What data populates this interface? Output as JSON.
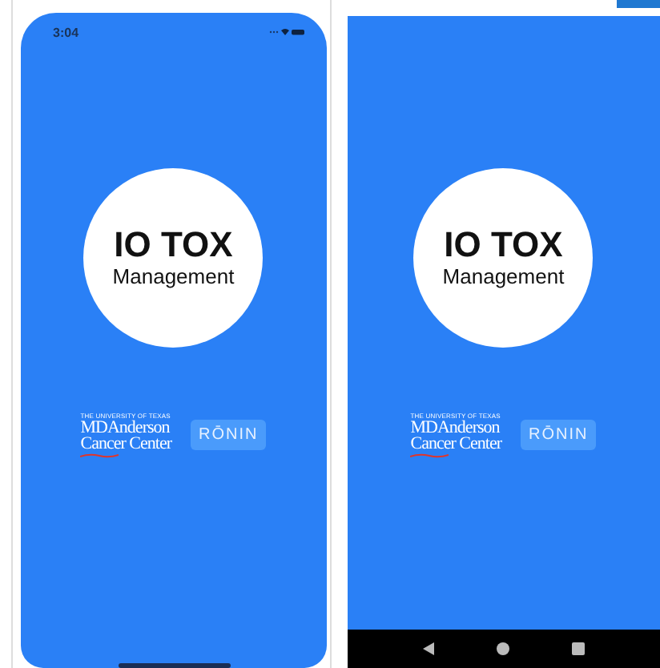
{
  "screens": [
    {
      "kind": "ios",
      "status_time": "3:04",
      "title": "IO TOX",
      "subtitle": "Management",
      "logo_university": "THE UNIVERSITY OF TEXAS",
      "logo_name": "MDAnderson",
      "logo_center": "Cancer Center",
      "partner_logo": "RŌNIN"
    },
    {
      "kind": "android",
      "title": "IO TOX",
      "subtitle": "Management",
      "logo_university": "THE UNIVERSITY OF TEXAS",
      "logo_name": "MDAnderson",
      "logo_center": "Cancer Center",
      "partner_logo": "RŌNIN"
    }
  ]
}
